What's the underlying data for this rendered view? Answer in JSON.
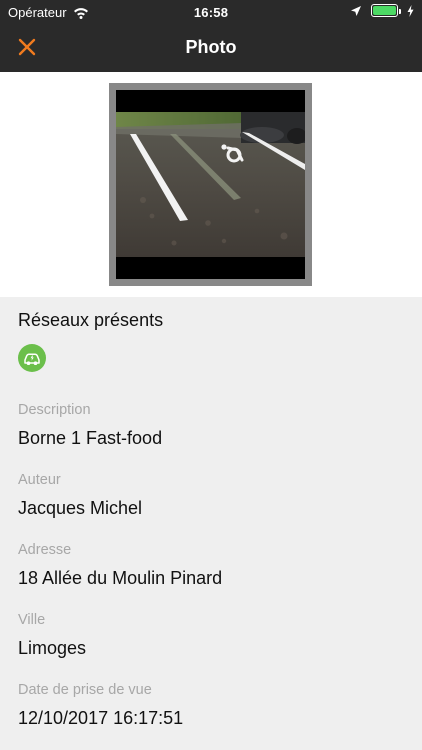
{
  "status_bar": {
    "carrier": "Opérateur",
    "time": "16:58",
    "battery_level": 1.0
  },
  "nav": {
    "title": "Photo"
  },
  "colors": {
    "nav_background": "#2a2a2a",
    "accent": "#f07b1f",
    "network_badge": "#6bbf4b",
    "label": "#a7a7a7",
    "page_background": "#efefef"
  },
  "networks": {
    "title": "Réseaux présents",
    "icon": "car-network-icon"
  },
  "fields": {
    "description": {
      "label": "Description",
      "value": "Borne 1 Fast-food"
    },
    "author": {
      "label": "Auteur",
      "value": "Jacques Michel"
    },
    "address": {
      "label": "Adresse",
      "value": "18 Allée du Moulin Pinard"
    },
    "city": {
      "label": "Ville",
      "value": "Limoges"
    },
    "date": {
      "label": "Date de prise de vue",
      "value": "12/10/2017 16:17:51"
    }
  }
}
